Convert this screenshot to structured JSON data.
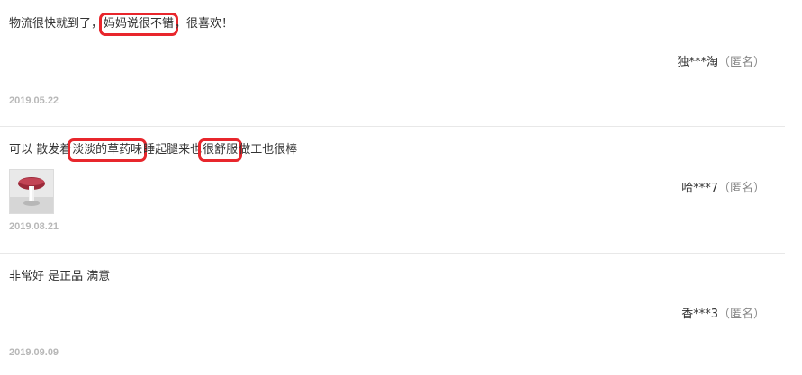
{
  "reviews": [
    {
      "segments": [
        "物流很快就到了，",
        "妈妈说很不错",
        "，很喜欢！"
      ],
      "user": "独***淘",
      "anon": "（匿名）",
      "date": "2019.05.22",
      "photo": false
    },
    {
      "segments": [
        "可以 散发着",
        "淡淡的草药味",
        "睡起腿来也",
        "很舒服",
        "做工也很棒"
      ],
      "user": "哈***7",
      "anon": "（匿名）",
      "date": "2019.08.21",
      "photo": true
    },
    {
      "segments": [
        "非常好 是正品 满意"
      ],
      "user": "香***3",
      "anon": "（匿名）",
      "date": "2019.09.09",
      "photo": false
    }
  ],
  "colors": {
    "highlight_border": "#e8262c",
    "date_text": "#b8b8b8",
    "divider": "#e8e8e8"
  }
}
